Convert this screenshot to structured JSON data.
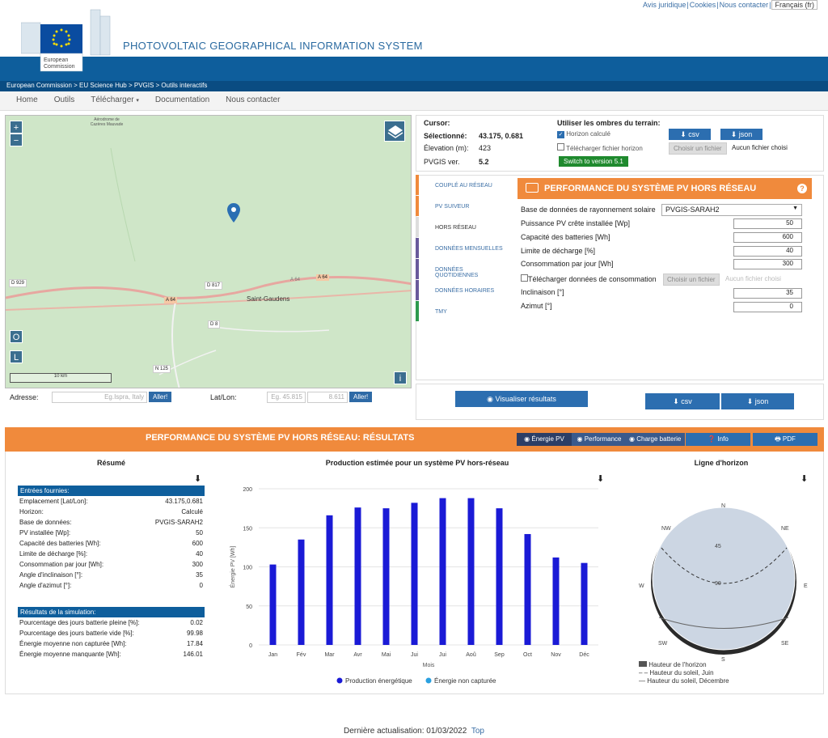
{
  "toplinks": {
    "legal": "Avis juridique",
    "cookies": "Cookies",
    "contact": "Nous contacter",
    "lang": "Français (fr)"
  },
  "logo": {
    "line1": "European",
    "line2": "Commission"
  },
  "site_title": "PHOTOVOLTAIC GEOGRAPHICAL INFORMATION SYSTEM",
  "breadcrumb": "European Commission > EU Science Hub > PVGIS > Outils interactifs",
  "nav": [
    "Home",
    "Outils",
    "Télécharger",
    "Documentation",
    "Nous contacter"
  ],
  "map": {
    "labels": {
      "airport": "Aérodrome de Cazères Mauvade",
      "d929": "D 929",
      "d817": "D 817",
      "a64a": "A 64",
      "a64b": "A 64",
      "a64c": "A 64",
      "city": "Saint-Gaudens",
      "d8": "D 8",
      "n125": "N 125",
      "scale": "10 km",
      "o": "O",
      "l": "L",
      "info": "i"
    }
  },
  "address": {
    "label": "Adresse:",
    "placeholder": "Eg.Ispra, Italy",
    "go": "Aller!",
    "latlon_label": "Lat/Lon:",
    "lat_ph": "Eg. 45.815",
    "lon_ph": "8.611",
    "go2": "Aller!"
  },
  "cursor": {
    "title": "Cursor:",
    "sel_label": "Sélectionné:",
    "sel_value": "43.175, 0.681",
    "elev_label": "Élevation (m):",
    "elev_value": "423",
    "ver_label": "PVGIS ver.",
    "ver_value": "5.2"
  },
  "shadows": {
    "title": "Utiliser les ombres du terrain:",
    "horizon": "Horizon calculé",
    "upload": "Télécharger fichier horizon",
    "switch": "Switch to version 5.1",
    "csv": "csv",
    "json": "json",
    "choose": "Choisir un fichier",
    "nofile": "Aucun fichier choisi"
  },
  "tabs": [
    {
      "label": "COUPLÉ AU RÉSEAU",
      "color": "#f08a3c"
    },
    {
      "label": "PV SUIVEUR",
      "color": "#f08a3c"
    },
    {
      "label": "HORS RÉSEAU",
      "color": "#ffffff"
    },
    {
      "label": "DONNÉES MENSUELLES",
      "color": "#6a5a9c"
    },
    {
      "label": "DONNÉES QUOTIDIENNES",
      "color": "#6a5a9c"
    },
    {
      "label": "DONNÉES HORAIRES",
      "color": "#6a5a9c"
    },
    {
      "label": "TMY",
      "color": "#2e9a4e"
    }
  ],
  "form": {
    "title": "PERFORMANCE DU SYSTÈME PV HORS RÉSEAU",
    "help": "?",
    "db_label": "Base de données de rayonnement solaire",
    "db_value": "PVGIS-SARAH2",
    "pv_label": "Puissance PV crête installée [Wp]",
    "pv_value": "50",
    "bat_label": "Capacité des batteries [Wh]",
    "bat_value": "600",
    "dis_label": "Limite de décharge [%]",
    "dis_value": "40",
    "cons_label": "Consommation par jour [Wh]",
    "cons_value": "300",
    "upload_label": "Télécharger données de consommation",
    "choose": "Choisir un fichier",
    "nofile": "Aucun fichier choisi",
    "incl_label": "Inclinaison [°]",
    "incl_value": "35",
    "az_label": "Azimut [°]",
    "az_value": "0"
  },
  "actions": {
    "visualize": "Visualiser résultats",
    "csv": "csv",
    "json": "json"
  },
  "results": {
    "title": "PERFORMANCE DU SYSTÈME PV HORS RÉSEAU: RÉSULTATS",
    "tabs": [
      "Énergie PV",
      "Performance",
      "Charge batterie"
    ],
    "info": "Info",
    "pdf": "PDF"
  },
  "summary": {
    "title": "Résumé",
    "inputs_title": "Entrées fournies:",
    "inputs": [
      [
        "Emplacement [Lat/Lon]:",
        "43.175,0.681"
      ],
      [
        "Horizon:",
        "Calculé"
      ],
      [
        "Base de données:",
        "PVGIS-SARAH2"
      ],
      [
        "PV installée [Wp]:",
        "50"
      ],
      [
        "Capacité des batteries [Wh]:",
        "600"
      ],
      [
        "Limite de décharge [%]:",
        "40"
      ],
      [
        "Consommation par jour [Wh]:",
        "300"
      ],
      [
        "Angle d'inclinaison [°]:",
        "35"
      ],
      [
        "Angle d'azimut [°]:",
        "0"
      ]
    ],
    "sim_title": "Résultats de la simulation:",
    "sim": [
      [
        "Pourcentage des jours batterie pleine [%]:",
        "0.02"
      ],
      [
        "Pourcentage des jours batterie vide [%]:",
        "99.98"
      ],
      [
        "Énergie moyenne non capturée [Wh]:",
        "17.84"
      ],
      [
        "Énergie moyenne manquante [Wh]:",
        "146.01"
      ]
    ]
  },
  "chart_data": {
    "type": "bar",
    "title": "Production estimée pour un système PV hors-réseau",
    "xlabel": "Mois",
    "ylabel": "Énergie PV [Wh]",
    "categories": [
      "Jan",
      "Fév",
      "Mar",
      "Avr",
      "Mai",
      "Jui",
      "Jui",
      "Aoû",
      "Sep",
      "Oct",
      "Nov",
      "Déc"
    ],
    "series": [
      {
        "name": "Production énergétique",
        "values": [
          103,
          135,
          166,
          176,
          175,
          182,
          188,
          188,
          175,
          142,
          112,
          105
        ],
        "color": "#1a1ad6"
      },
      {
        "name": "Énergie non capturée",
        "values": [
          0,
          0,
          0,
          0,
          0,
          0,
          0,
          0,
          0,
          0,
          0,
          0
        ],
        "color": "#2aa0e0"
      }
    ],
    "ylim": [
      0,
      200
    ],
    "yticks": [
      0,
      50,
      100,
      150,
      200
    ],
    "grid": true,
    "legend": "bottom"
  },
  "horizon": {
    "title": "Ligne d'horizon",
    "n": "N",
    "ne": "NE",
    "e": "E",
    "se": "SE",
    "s": "S",
    "sw": "SW",
    "w": "W",
    "nw": "NW",
    "r45": "45",
    "r90": "90",
    "legend": [
      "Hauteur de l'horizon",
      "Hauteur du soleil, Juin",
      "Hauteur du soleil, Décembre"
    ]
  },
  "footer": {
    "text": "Dernière actualisation: 01/03/2022",
    "top": "Top"
  }
}
